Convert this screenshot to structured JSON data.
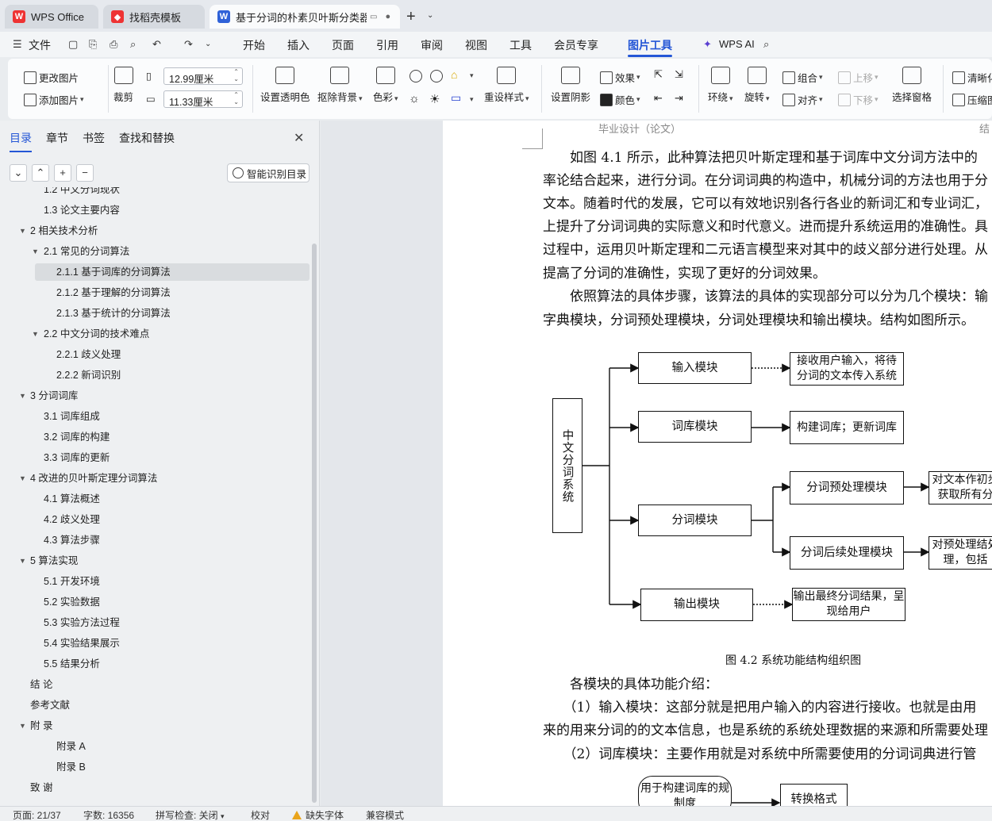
{
  "tabs": [
    {
      "label": "WPS Office",
      "icon": "wps-logo-icon"
    },
    {
      "label": "找稻壳模板",
      "icon": "docer-icon"
    },
    {
      "label": "基于分词的朴素贝叶斯分类器",
      "icon": "word-doc-icon"
    }
  ],
  "menu": {
    "file": "文件",
    "items": [
      "开始",
      "插入",
      "页面",
      "引用",
      "审阅",
      "视图",
      "工具",
      "会员专享",
      "图片工具"
    ],
    "active": "图片工具",
    "wps_ai": "WPS AI"
  },
  "ribbon": {
    "change_picture": "更改图片",
    "add_picture": "添加图片",
    "crop": "裁剪",
    "width": "12.99厘米",
    "height": "11.33厘米",
    "set_transparent": "设置透明色",
    "remove_bg": "抠除背景",
    "color": "色彩",
    "reset_style": "重设样式",
    "set_shadow": "设置阴影",
    "effects": "效果",
    "fill_color": "颜色",
    "wrap": "环绕",
    "rotate": "旋转",
    "group": "组合",
    "align": "对齐",
    "bring_forward": "上移",
    "send_backward": "下移",
    "selection_pane": "选择窗格",
    "clarity": "清晰化",
    "compress": "压缩图"
  },
  "sidebar": {
    "tabs": [
      "目录",
      "章节",
      "书签",
      "查找和替换"
    ],
    "smart_toc": "智能识别目录",
    "toc": [
      {
        "label": "1.2 中文分词现状",
        "level": 2
      },
      {
        "label": "1.3  论文主要内容",
        "level": 2
      },
      {
        "label": "2 相关技术分析",
        "level": 1,
        "expanded": true
      },
      {
        "label": "2.1 常见的分词算法",
        "level": 2,
        "expanded": true
      },
      {
        "label": "2.1.1 基于词库的分词算法",
        "level": 3,
        "selected": true
      },
      {
        "label": "2.1.2 基于理解的分词算法",
        "level": 3
      },
      {
        "label": "2.1.3 基于统计的分词算法",
        "level": 3
      },
      {
        "label": "2.2 中文分词的技术难点",
        "level": 2,
        "expanded": true
      },
      {
        "label": "2.2.1 歧义处理",
        "level": 3
      },
      {
        "label": "2.2.2 新词识别",
        "level": 3
      },
      {
        "label": "3 分词词库",
        "level": 1,
        "expanded": true
      },
      {
        "label": "3.1 词库组成",
        "level": 2
      },
      {
        "label": "3.2  词库的构建",
        "level": 2
      },
      {
        "label": "3.3  词库的更新",
        "level": 2
      },
      {
        "label": "4  改进的贝叶斯定理分词算法",
        "level": 1,
        "expanded": true
      },
      {
        "label": "4.1  算法概述",
        "level": 2
      },
      {
        "label": "4.2  歧义处理",
        "level": 2
      },
      {
        "label": "4.3  算法步骤",
        "level": 2
      },
      {
        "label": "5  算法实现",
        "level": 1,
        "expanded": true
      },
      {
        "label": "5.1  开发环境",
        "level": 2
      },
      {
        "label": "5.2  实验数据",
        "level": 2
      },
      {
        "label": "5.3  实验方法过程",
        "level": 2
      },
      {
        "label": "5.4  实验结果展示",
        "level": 2
      },
      {
        "label": "5.5 结果分析",
        "level": 2
      },
      {
        "label": "结  论",
        "level": 1
      },
      {
        "label": "参考文献",
        "level": 1
      },
      {
        "label": "附  录",
        "level": 1,
        "expanded": true
      },
      {
        "label": "附录  A",
        "level": 3
      },
      {
        "label": "附录  B",
        "level": 3
      },
      {
        "label": "致  谢",
        "level": 1
      }
    ]
  },
  "document": {
    "header_left": "毕业设计（论文）",
    "header_right": "结",
    "paragraphs": [
      "　　如图  4.1  所示，此种算法把贝叶斯定理和基于词库中文分词方法中的",
      "率论结合起来，进行分词。在分词词典的构造中，机械分词的方法也用于分",
      "文本。随着时代的发展，它可以有效地识别各行各业的新词汇和专业词汇，",
      "上提升了分词词典的实际意义和时代意义。进而提升系统运用的准确性。具",
      "过程中，运用贝叶斯定理和二元语言模型来对其中的歧义部分进行处理。从",
      "提高了分词的准确性，实现了更好的分词效果。",
      "　　依照算法的具体步骤，该算法的具体的实现部分可以分为几个模块：输",
      "字典模块，分词预处理模块，分词处理模块和输出模块。结构如图所示。"
    ],
    "diagram": {
      "root": "中文分词系统",
      "input_module": "输入模块",
      "input_desc": "接收用户输入，将待分词的文本传入系统",
      "dict_module": "词库模块",
      "dict_desc": "构建词库；更新词库",
      "seg_module": "分词模块",
      "pre_module": "分词预处理模块",
      "pre_desc": "对文本作初步获取所有分",
      "post_module": "分词后续处理模块",
      "post_desc": "对预处理结处理，包括",
      "output_module": "输出模块",
      "output_desc": "输出最终分词结果，呈现给用户"
    },
    "caption": "图 4.2 系统功能结构组织图",
    "after": [
      "　　各模块的具体功能介绍：",
      "　　（1）输入模块：这部分就是把用户输入的内容进行接收。也就是由用",
      "来的用来分词的的文本信息，也是系统的系统处理数据的来源和所需要处理",
      "　　（2）词库模块：主要作用就是对系统中所需要使用的分词词典进行管"
    ],
    "flow": {
      "start": "用于构建词库的规制度",
      "convert": "转换格式"
    }
  },
  "status": {
    "page": "页面: 21/37",
    "words": "字数: 16356",
    "spell": "拼写检查: 关闭",
    "proof": "校对",
    "missing_font": "缺失字体",
    "compat": "兼容模式"
  }
}
